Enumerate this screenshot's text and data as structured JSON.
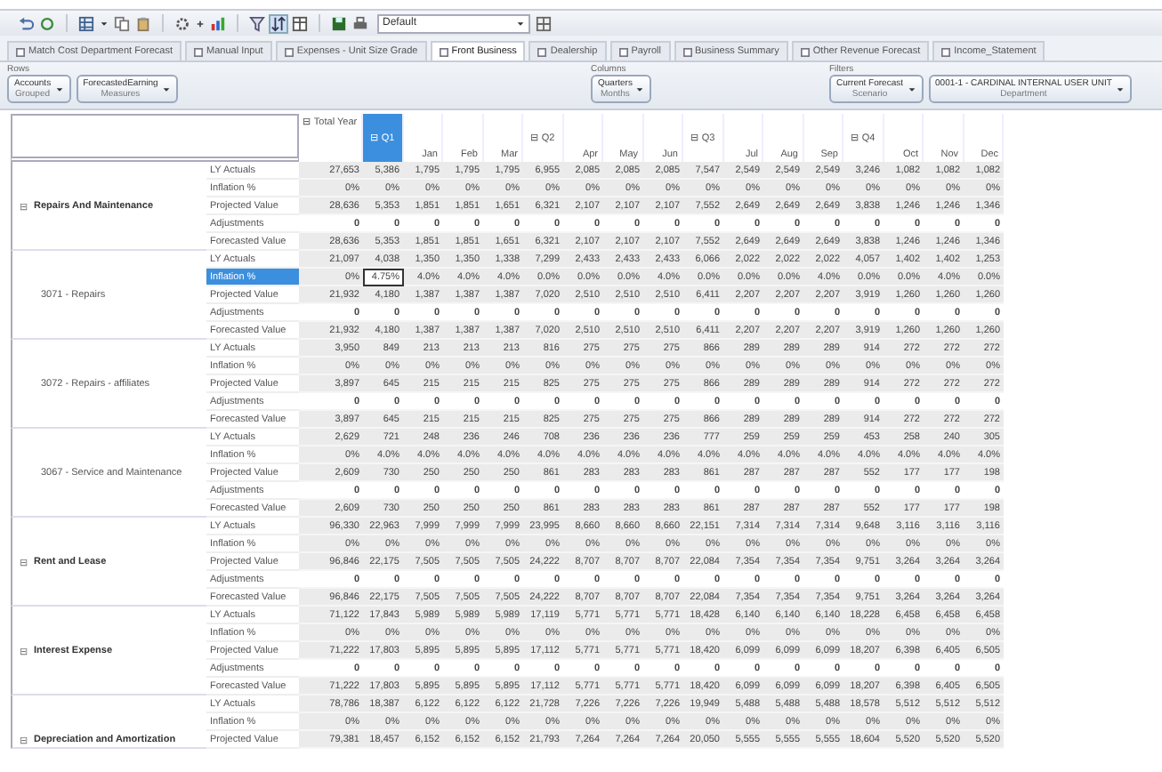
{
  "toolbar": {
    "dropdown_value": "Default"
  },
  "tabs": [
    {
      "label": "Match Cost Department Forecast",
      "selected": false
    },
    {
      "label": "Manual Input",
      "selected": false
    },
    {
      "label": "Expenses - Unit Size Grade",
      "selected": false
    },
    {
      "label": "Front Business",
      "selected": true
    },
    {
      "label": "Dealership",
      "selected": false
    },
    {
      "label": "Payroll",
      "selected": false
    },
    {
      "label": "Business Summary",
      "selected": false
    },
    {
      "label": "Other Revenue Forecast",
      "selected": false
    },
    {
      "label": "Income_Statement",
      "selected": false
    }
  ],
  "filter_zones": [
    {
      "label": "Rows",
      "chips": [
        {
          "title": "Accounts",
          "subtitle": "Grouped"
        },
        {
          "title": "ForecastedEarning",
          "subtitle": "Measures"
        }
      ]
    },
    {
      "label": "Columns",
      "chips": [
        {
          "title": "Quarters",
          "subtitle": "Months"
        }
      ]
    },
    {
      "label": "Filters",
      "chips": [
        {
          "title": "Current Forecast",
          "subtitle": "Scenario"
        },
        {
          "title": "0001-1 - CARDINAL INTERNAL USER UNIT",
          "subtitle": "Department"
        }
      ]
    }
  ],
  "table": {
    "columns": [
      {
        "label": "⊟ Total Year",
        "kind": "year",
        "selected": false
      },
      {
        "label": "⊟ Q1",
        "kind": "quarter",
        "selected": true
      },
      {
        "label": "Jan",
        "kind": "month",
        "selected": false
      },
      {
        "label": "Feb",
        "kind": "month",
        "selected": false
      },
      {
        "label": "Mar",
        "kind": "month",
        "selected": false
      },
      {
        "label": "⊟ Q2",
        "kind": "quarter",
        "selected": false
      },
      {
        "label": "Apr",
        "kind": "month",
        "selected": false
      },
      {
        "label": "May",
        "kind": "month",
        "selected": false
      },
      {
        "label": "Jun",
        "kind": "month",
        "selected": false
      },
      {
        "label": "⊟ Q3",
        "kind": "quarter",
        "selected": false
      },
      {
        "label": "Jul",
        "kind": "month",
        "selected": false
      },
      {
        "label": "Aug",
        "kind": "month",
        "selected": false
      },
      {
        "label": "Sep",
        "kind": "month",
        "selected": false
      },
      {
        "label": "⊟ Q4",
        "kind": "quarter",
        "selected": false
      },
      {
        "label": "Oct",
        "kind": "month",
        "selected": false
      },
      {
        "label": "Nov",
        "kind": "month",
        "selected": false
      },
      {
        "label": "Dec",
        "kind": "month",
        "selected": false
      }
    ],
    "groups": [
      {
        "label": "Repairs And Maintenance",
        "kind": "account",
        "toggle": "⊟",
        "rows": [
          {
            "measure": "LY Actuals",
            "selected": false,
            "editable": false,
            "values": [
              "27,653",
              "5,386",
              "1,795",
              "1,795",
              "1,795",
              "6,955",
              "2,085",
              "2,085",
              "2,085",
              "7,547",
              "2,549",
              "2,549",
              "2,549",
              "3,246",
              "1,082",
              "1,082",
              "1,082"
            ]
          },
          {
            "measure": "Inflation %",
            "selected": false,
            "editable": false,
            "values": [
              "0%",
              "0%",
              "0%",
              "0%",
              "0%",
              "0%",
              "0%",
              "0%",
              "0%",
              "0%",
              "0%",
              "0%",
              "0%",
              "0%",
              "0%",
              "0%",
              "0%"
            ]
          },
          {
            "measure": "Projected Value",
            "selected": false,
            "editable": false,
            "values": [
              "28,636",
              "5,353",
              "1,851",
              "1,851",
              "1,651",
              "6,321",
              "2,107",
              "2,107",
              "2,107",
              "7,552",
              "2,649",
              "2,649",
              "2,649",
              "3,838",
              "1,246",
              "1,246",
              "1,346"
            ]
          },
          {
            "measure": "Adjustments",
            "selected": false,
            "editable": true,
            "values": [
              "0",
              "0",
              "0",
              "0",
              "0",
              "0",
              "0",
              "0",
              "0",
              "0",
              "0",
              "0",
              "0",
              "0",
              "0",
              "0",
              "0"
            ]
          },
          {
            "measure": "Forecasted Value",
            "selected": false,
            "editable": false,
            "values": [
              "28,636",
              "5,353",
              "1,851",
              "1,851",
              "1,651",
              "6,321",
              "2,107",
              "2,107",
              "2,107",
              "7,552",
              "2,649",
              "2,649",
              "2,649",
              "3,838",
              "1,246",
              "1,246",
              "1,346"
            ]
          }
        ]
      },
      {
        "label": "3071 - Repairs",
        "kind": "sub",
        "rows": [
          {
            "measure": "LY Actuals",
            "selected": false,
            "editable": false,
            "values": [
              "21,097",
              "4,038",
              "1,350",
              "1,350",
              "1,338",
              "7,299",
              "2,433",
              "2,433",
              "2,433",
              "6,066",
              "2,022",
              "2,022",
              "2,022",
              "4,057",
              "1,402",
              "1,402",
              "1,253"
            ]
          },
          {
            "measure": "Inflation %",
            "selected": true,
            "editable": false,
            "values": [
              "0%",
              "4.75%",
              "4.0%",
              "4.0%",
              "4.0%",
              "0.0%",
              "0.0%",
              "0.0%",
              "4.0%",
              "0.0%",
              "0.0%",
              "0.0%",
              "4.0%",
              "0.0%",
              "0.0%",
              "4.0%",
              "0.0%"
            ]
          },
          {
            "measure": "Projected Value",
            "selected": false,
            "editable": false,
            "values": [
              "21,932",
              "4,180",
              "1,387",
              "1,387",
              "1,387",
              "7,020",
              "2,510",
              "2,510",
              "2,510",
              "6,411",
              "2,207",
              "2,207",
              "2,207",
              "3,919",
              "1,260",
              "1,260",
              "1,260"
            ]
          },
          {
            "measure": "Adjustments",
            "selected": false,
            "editable": true,
            "values": [
              "0",
              "0",
              "0",
              "0",
              "0",
              "0",
              "0",
              "0",
              "0",
              "0",
              "0",
              "0",
              "0",
              "0",
              "0",
              "0",
              "0"
            ]
          },
          {
            "measure": "Forecasted Value",
            "selected": false,
            "editable": false,
            "values": [
              "21,932",
              "4,180",
              "1,387",
              "1,387",
              "1,387",
              "7,020",
              "2,510",
              "2,510",
              "2,510",
              "6,411",
              "2,207",
              "2,207",
              "2,207",
              "3,919",
              "1,260",
              "1,260",
              "1,260"
            ]
          }
        ]
      },
      {
        "label": "3072 - Repairs - affiliates",
        "kind": "sub",
        "rows": [
          {
            "measure": "LY Actuals",
            "selected": false,
            "editable": false,
            "values": [
              "3,950",
              "849",
              "213",
              "213",
              "213",
              "816",
              "275",
              "275",
              "275",
              "866",
              "289",
              "289",
              "289",
              "914",
              "272",
              "272",
              "272"
            ]
          },
          {
            "measure": "Inflation %",
            "selected": false,
            "editable": false,
            "values": [
              "0%",
              "0%",
              "0%",
              "0%",
              "0%",
              "0%",
              "0%",
              "0%",
              "0%",
              "0%",
              "0%",
              "0%",
              "0%",
              "0%",
              "0%",
              "0%",
              "0%"
            ]
          },
          {
            "measure": "Projected Value",
            "selected": false,
            "editable": false,
            "values": [
              "3,897",
              "645",
              "215",
              "215",
              "215",
              "825",
              "275",
              "275",
              "275",
              "866",
              "289",
              "289",
              "289",
              "914",
              "272",
              "272",
              "272"
            ]
          },
          {
            "measure": "Adjustments",
            "selected": false,
            "editable": true,
            "values": [
              "0",
              "0",
              "0",
              "0",
              "0",
              "0",
              "0",
              "0",
              "0",
              "0",
              "0",
              "0",
              "0",
              "0",
              "0",
              "0",
              "0"
            ]
          },
          {
            "measure": "Forecasted Value",
            "selected": false,
            "editable": false,
            "values": [
              "3,897",
              "645",
              "215",
              "215",
              "215",
              "825",
              "275",
              "275",
              "275",
              "866",
              "289",
              "289",
              "289",
              "914",
              "272",
              "272",
              "272"
            ]
          }
        ]
      },
      {
        "label": "3067 - Service and Maintenance",
        "kind": "sub",
        "rows": [
          {
            "measure": "LY Actuals",
            "selected": false,
            "editable": false,
            "values": [
              "2,629",
              "721",
              "248",
              "236",
              "246",
              "708",
              "236",
              "236",
              "236",
              "777",
              "259",
              "259",
              "259",
              "453",
              "258",
              "240",
              "305"
            ]
          },
          {
            "measure": "Inflation %",
            "selected": false,
            "editable": false,
            "values": [
              "0%",
              "4.0%",
              "4.0%",
              "4.0%",
              "4.0%",
              "4.0%",
              "4.0%",
              "4.0%",
              "4.0%",
              "4.0%",
              "4.0%",
              "4.0%",
              "4.0%",
              "4.0%",
              "4.0%",
              "4.0%",
              "4.0%"
            ]
          },
          {
            "measure": "Projected Value",
            "selected": false,
            "editable": false,
            "values": [
              "2,609",
              "730",
              "250",
              "250",
              "250",
              "861",
              "283",
              "283",
              "283",
              "861",
              "287",
              "287",
              "287",
              "552",
              "177",
              "177",
              "198"
            ]
          },
          {
            "measure": "Adjustments",
            "selected": false,
            "editable": true,
            "values": [
              "0",
              "0",
              "0",
              "0",
              "0",
              "0",
              "0",
              "0",
              "0",
              "0",
              "0",
              "0",
              "0",
              "0",
              "0",
              "0",
              "0"
            ]
          },
          {
            "measure": "Forecasted Value",
            "selected": false,
            "editable": false,
            "values": [
              "2,609",
              "730",
              "250",
              "250",
              "250",
              "861",
              "283",
              "283",
              "283",
              "861",
              "287",
              "287",
              "287",
              "552",
              "177",
              "177",
              "198"
            ]
          }
        ]
      },
      {
        "label": "Rent and Lease",
        "kind": "account",
        "toggle": "⊟",
        "rows": [
          {
            "measure": "LY Actuals",
            "selected": false,
            "editable": false,
            "values": [
              "96,330",
              "22,963",
              "7,999",
              "7,999",
              "7,999",
              "23,995",
              "8,660",
              "8,660",
              "8,660",
              "22,151",
              "7,314",
              "7,314",
              "7,314",
              "9,648",
              "3,116",
              "3,116",
              "3,116"
            ]
          },
          {
            "measure": "Inflation %",
            "selected": false,
            "editable": false,
            "values": [
              "0%",
              "0%",
              "0%",
              "0%",
              "0%",
              "0%",
              "0%",
              "0%",
              "0%",
              "0%",
              "0%",
              "0%",
              "0%",
              "0%",
              "0%",
              "0%",
              "0%"
            ]
          },
          {
            "measure": "Projected Value",
            "selected": false,
            "editable": false,
            "values": [
              "96,846",
              "22,175",
              "7,505",
              "7,505",
              "7,505",
              "24,222",
              "8,707",
              "8,707",
              "8,707",
              "22,084",
              "7,354",
              "7,354",
              "7,354",
              "9,751",
              "3,264",
              "3,264",
              "3,264"
            ]
          },
          {
            "measure": "Adjustments",
            "selected": false,
            "editable": true,
            "values": [
              "0",
              "0",
              "0",
              "0",
              "0",
              "0",
              "0",
              "0",
              "0",
              "0",
              "0",
              "0",
              "0",
              "0",
              "0",
              "0",
              "0"
            ]
          },
          {
            "measure": "Forecasted Value",
            "selected": false,
            "editable": false,
            "values": [
              "96,846",
              "22,175",
              "7,505",
              "7,505",
              "7,505",
              "24,222",
              "8,707",
              "8,707",
              "8,707",
              "22,084",
              "7,354",
              "7,354",
              "7,354",
              "9,751",
              "3,264",
              "3,264",
              "3,264"
            ]
          }
        ]
      },
      {
        "label": "Interest Expense",
        "kind": "account",
        "toggle": "⊟",
        "rows": [
          {
            "measure": "LY Actuals",
            "selected": false,
            "editable": false,
            "values": [
              "71,122",
              "17,843",
              "5,989",
              "5,989",
              "5,989",
              "17,119",
              "5,771",
              "5,771",
              "5,771",
              "18,428",
              "6,140",
              "6,140",
              "6,140",
              "18,228",
              "6,458",
              "6,458",
              "6,458"
            ]
          },
          {
            "measure": "Inflation %",
            "selected": false,
            "editable": false,
            "values": [
              "0%",
              "0%",
              "0%",
              "0%",
              "0%",
              "0%",
              "0%",
              "0%",
              "0%",
              "0%",
              "0%",
              "0%",
              "0%",
              "0%",
              "0%",
              "0%",
              "0%"
            ]
          },
          {
            "measure": "Projected Value",
            "selected": false,
            "editable": false,
            "values": [
              "71,222",
              "17,803",
              "5,895",
              "5,895",
              "5,895",
              "17,112",
              "5,771",
              "5,771",
              "5,771",
              "18,420",
              "6,099",
              "6,099",
              "6,099",
              "18,207",
              "6,398",
              "6,405",
              "6,505"
            ]
          },
          {
            "measure": "Adjustments",
            "selected": false,
            "editable": true,
            "values": [
              "0",
              "0",
              "0",
              "0",
              "0",
              "0",
              "0",
              "0",
              "0",
              "0",
              "0",
              "0",
              "0",
              "0",
              "0",
              "0",
              "0"
            ]
          },
          {
            "measure": "Forecasted Value",
            "selected": false,
            "editable": false,
            "values": [
              "71,222",
              "17,803",
              "5,895",
              "5,895",
              "5,895",
              "17,112",
              "5,771",
              "5,771",
              "5,771",
              "18,420",
              "6,099",
              "6,099",
              "6,099",
              "18,207",
              "6,398",
              "6,405",
              "6,505"
            ]
          }
        ]
      },
      {
        "label": "Depreciation and Amortization",
        "kind": "account",
        "toggle": "⊟",
        "rows": [
          {
            "measure": "LY Actuals",
            "selected": false,
            "editable": false,
            "values": [
              "78,786",
              "18,387",
              "6,122",
              "6,122",
              "6,122",
              "21,728",
              "7,226",
              "7,226",
              "7,226",
              "19,949",
              "5,488",
              "5,488",
              "5,488",
              "18,578",
              "5,512",
              "5,512",
              "5,512"
            ]
          },
          {
            "measure": "Inflation %",
            "selected": false,
            "editable": false,
            "values": [
              "0%",
              "0%",
              "0%",
              "0%",
              "0%",
              "0%",
              "0%",
              "0%",
              "0%",
              "0%",
              "0%",
              "0%",
              "0%",
              "0%",
              "0%",
              "0%",
              "0%"
            ]
          },
          {
            "measure": "Projected Value",
            "selected": false,
            "editable": false,
            "values": [
              "79,381",
              "18,457",
              "6,152",
              "6,152",
              "6,152",
              "21,793",
              "7,264",
              "7,264",
              "7,264",
              "20,050",
              "5,555",
              "5,555",
              "5,555",
              "18,604",
              "5,520",
              "5,520",
              "5,520"
            ]
          }
        ]
      }
    ]
  }
}
